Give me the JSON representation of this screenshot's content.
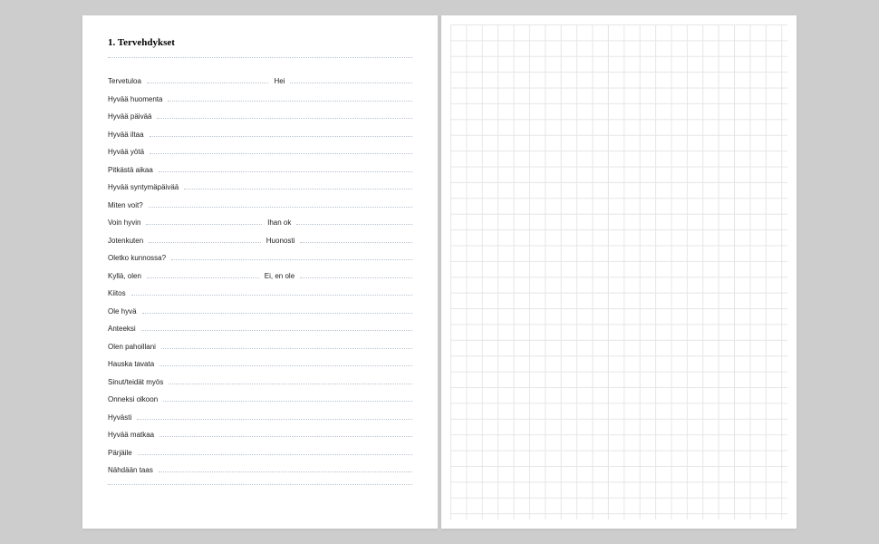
{
  "leftPage": {
    "heading": "1. Tervehdykset",
    "rows": [
      {
        "type": "dotsOnly",
        "tall": true
      },
      {
        "type": "split",
        "left": "Tervetuloa",
        "right": "Hei"
      },
      {
        "type": "single",
        "term": "Hyvää huomenta"
      },
      {
        "type": "single",
        "term": "Hyvää päivää"
      },
      {
        "type": "single",
        "term": "Hyvää iltaa"
      },
      {
        "type": "single",
        "term": "Hyvää yötä"
      },
      {
        "type": "single",
        "term": "Pitkästä aikaa"
      },
      {
        "type": "single",
        "term": "Hyvää syntymäpäivää"
      },
      {
        "type": "single",
        "term": "Miten voit?"
      },
      {
        "type": "split",
        "left": "Voin hyvin",
        "right": "Ihan ok"
      },
      {
        "type": "split",
        "left": "Jotenkuten",
        "right": "Huonosti"
      },
      {
        "type": "single",
        "term": "Oletko kunnossa?"
      },
      {
        "type": "split",
        "left": "Kyllä, olen",
        "right": "Ei, en ole"
      },
      {
        "type": "single",
        "term": "Kiitos"
      },
      {
        "type": "single",
        "term": "Ole hyvä"
      },
      {
        "type": "single",
        "term": "Anteeksi"
      },
      {
        "type": "single",
        "term": "Olen pahoillani"
      },
      {
        "type": "single",
        "term": "Hauska tavata"
      },
      {
        "type": "single",
        "term": "Sinut/teidät myös"
      },
      {
        "type": "single",
        "term": "Onneksi olkoon"
      },
      {
        "type": "single",
        "term": "Hyvästi"
      },
      {
        "type": "single",
        "term": "Hyvää matkaa"
      },
      {
        "type": "single",
        "term": "Pärjäile"
      },
      {
        "type": "single",
        "term": "Nähdään taas"
      },
      {
        "type": "dotsOnly",
        "tall": true
      }
    ]
  }
}
